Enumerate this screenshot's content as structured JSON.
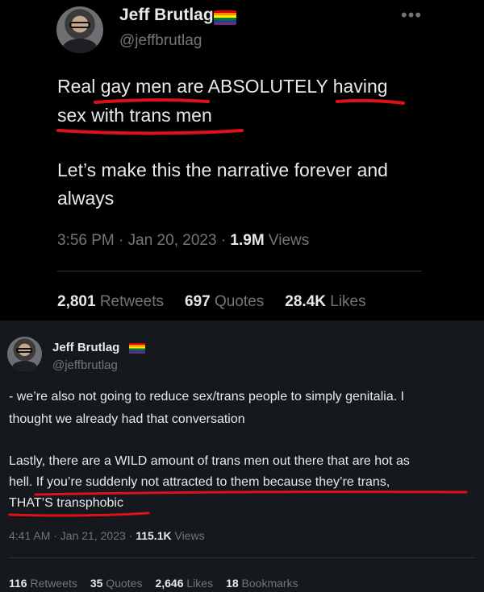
{
  "top_tweet": {
    "name": "Jeff Brutlag",
    "handle": "@jeffbrutlag",
    "more": "•••",
    "text_lines": [
      "Real gay men are ABSOLUTELY having",
      "sex with trans men",
      "Let’s make this the narrative forever and",
      "always"
    ],
    "time": "3:56 PM · Jan 20, 2023 · ",
    "views_count": "1.9M",
    "views_label": " Views",
    "stats": [
      {
        "count": "2,801",
        "label": " Retweets"
      },
      {
        "count": "697",
        "label": " Quotes"
      },
      {
        "count": "28.4K",
        "label": " Likes"
      }
    ]
  },
  "bottom_tweet": {
    "name": "Jeff Brutlag",
    "handle": "@jeffbrutlag",
    "text_lines": [
      "- we’re also not going to reduce sex/trans people to simply genitalia. I",
      "thought we already had that conversation",
      "Lastly, there are a WILD amount of trans men out there that are hot as",
      "hell. If you’re suddenly not attracted to them because they’re trans,",
      "THAT’S transphobic"
    ],
    "time": "4:41 AM · Jan 21, 2023 · ",
    "views_count": "115.1K",
    "views_label": " Views",
    "stats": [
      {
        "count": "116",
        "label": " Retweets"
      },
      {
        "count": "35",
        "label": " Quotes"
      },
      {
        "count": "2,646",
        "label": " Likes"
      },
      {
        "count": "18",
        "label": " Bookmarks"
      }
    ]
  },
  "colors": {
    "background_top": "#000000",
    "background_bottom": "#15181c",
    "text_primary": "#e7e9ea",
    "text_secondary": "#71767b",
    "annotation_red": "#e0101a"
  },
  "icons": [
    "avatar",
    "pride-flag-icon",
    "more-options-icon"
  ]
}
